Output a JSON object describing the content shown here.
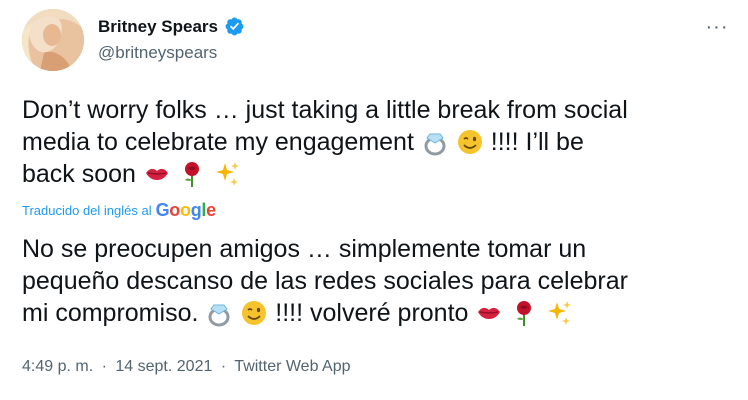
{
  "user": {
    "display_name": "Britney Spears",
    "handle": "@britneyspears",
    "verified": true
  },
  "more_menu": {
    "icon": "more-horizontal-icon",
    "label": "···"
  },
  "tweet": {
    "original": {
      "line1": "Don’t worry folks … just taking a little break from social",
      "line2a": "media to celebrate my engagement",
      "line2b": " !!!!  I’ll be",
      "line3": "back soon"
    },
    "translation_label": "Traducido del inglés al",
    "translation_provider": "Google",
    "translated": {
      "line1": "No se preocupen amigos … simplemente tomar un",
      "line2": "pequeño descanso de las redes sociales para celebrar",
      "line3a": "mi compromiso.",
      "line3b": " !!!! volveré pronto"
    }
  },
  "meta": {
    "time": "4:49 p. m.",
    "date": "14 sept. 2021",
    "source": "Twitter Web App",
    "separator": "·"
  },
  "colors": {
    "accent": "#1d9bf0",
    "secondary_text": "#536471",
    "primary_text": "#0f1419"
  },
  "icons": [
    "ring-icon",
    "winking-face-icon",
    "kiss-mark-icon",
    "rose-icon",
    "sparkles-icon",
    "verified-badge-icon"
  ]
}
